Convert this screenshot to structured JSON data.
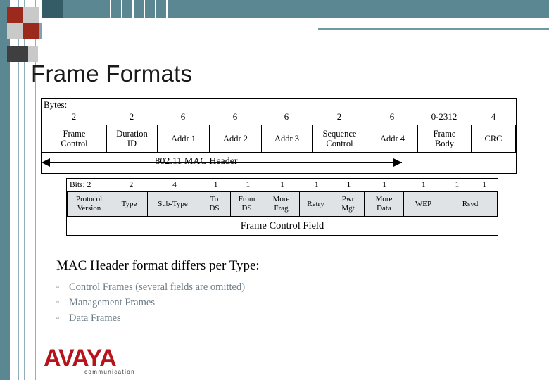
{
  "slide": {
    "title": "Frame Formats",
    "subhead": "MAC Header format differs per Type:",
    "bullets": [
      "Control Frames (several fields are omitted)",
      "Management Frames",
      "Data Frames"
    ],
    "bullet_mark": "▫"
  },
  "mac_header": {
    "bytes_label": "Bytes:",
    "span_caption": "802.11 MAC Header",
    "sizes": [
      "2",
      "2",
      "6",
      "6",
      "6",
      "2",
      "6",
      "0-2312",
      "4"
    ],
    "fields": [
      "Frame\nControl",
      "Duration\nID",
      "Addr 1",
      "Addr 2",
      "Addr 3",
      "Sequence\nControl",
      "Addr 4",
      "Frame\nBody",
      "CRC"
    ]
  },
  "frame_control": {
    "bits_label": "Bits: 2",
    "caption": "Frame Control Field",
    "sizes": [
      "Bits: 2",
      "2",
      "4",
      "1",
      "1",
      "1",
      "1",
      "1",
      "1",
      "1",
      "1",
      "1"
    ],
    "fields": [
      "Protocol\nVersion",
      "Type",
      "Sub-Type",
      "To\nDS",
      "From\nDS",
      "More\nFrag",
      "Retry",
      "Pwr\nMgt",
      "More\nData",
      "WEP",
      "Rsvd"
    ]
  },
  "logo": {
    "name": "AVAYA",
    "tagline": "communication"
  },
  "colors": {
    "teal": "#5b8792",
    "teal_dark": "#335c66",
    "red": "#9c2a1c",
    "bullet_text": "#6a7b85",
    "logo_red": "#b6131a",
    "shade": "#dfe3e6"
  }
}
